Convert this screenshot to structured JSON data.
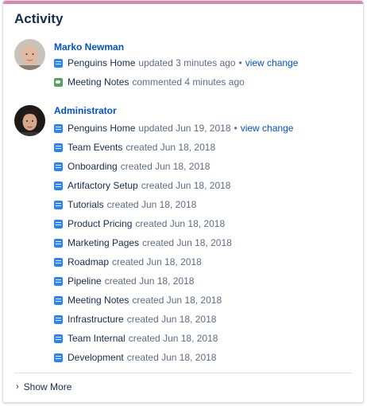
{
  "header": {
    "title": "Activity"
  },
  "groups": [
    {
      "user": "Marko Newman",
      "items": [
        {
          "icon": "page-icon",
          "page": "Penguins Home",
          "action": "updated 3 minutes ago",
          "link": "view change"
        },
        {
          "icon": "comment-icon",
          "page": "Meeting Notes",
          "action": "commented 4 minutes ago"
        }
      ]
    },
    {
      "user": "Administrator",
      "items": [
        {
          "icon": "page-icon",
          "page": "Penguins Home",
          "action": "updated Jun 19, 2018",
          "link": "view change"
        },
        {
          "icon": "page-icon",
          "page": "Team Events",
          "action": "created Jun 18, 2018"
        },
        {
          "icon": "page-icon",
          "page": "Onboarding",
          "action": "created Jun 18, 2018"
        },
        {
          "icon": "page-icon",
          "page": "Artifactory Setup",
          "action": "created Jun 18, 2018"
        },
        {
          "icon": "page-icon",
          "page": "Tutorials",
          "action": "created Jun 18, 2018"
        },
        {
          "icon": "page-icon",
          "page": "Product Pricing",
          "action": "created Jun 18, 2018"
        },
        {
          "icon": "page-icon",
          "page": "Marketing Pages",
          "action": "created Jun 18, 2018"
        },
        {
          "icon": "page-icon",
          "page": "Roadmap",
          "action": "created Jun 18, 2018"
        },
        {
          "icon": "page-icon",
          "page": "Pipeline",
          "action": "created Jun 18, 2018"
        },
        {
          "icon": "page-icon",
          "page": "Meeting Notes",
          "action": "created Jun 18, 2018"
        },
        {
          "icon": "page-icon",
          "page": "Infrastructure",
          "action": "created Jun 18, 2018"
        },
        {
          "icon": "page-icon",
          "page": "Team Internal",
          "action": "created Jun 18, 2018"
        },
        {
          "icon": "page-icon",
          "page": "Development",
          "action": "created Jun 18, 2018"
        }
      ]
    }
  ],
  "footer": {
    "show_more": "Show More"
  },
  "colors": {
    "accent_bar": "#d987b0",
    "link": "#0052cc",
    "page_icon": "#2684ff",
    "comment_icon": "#57a55a"
  }
}
